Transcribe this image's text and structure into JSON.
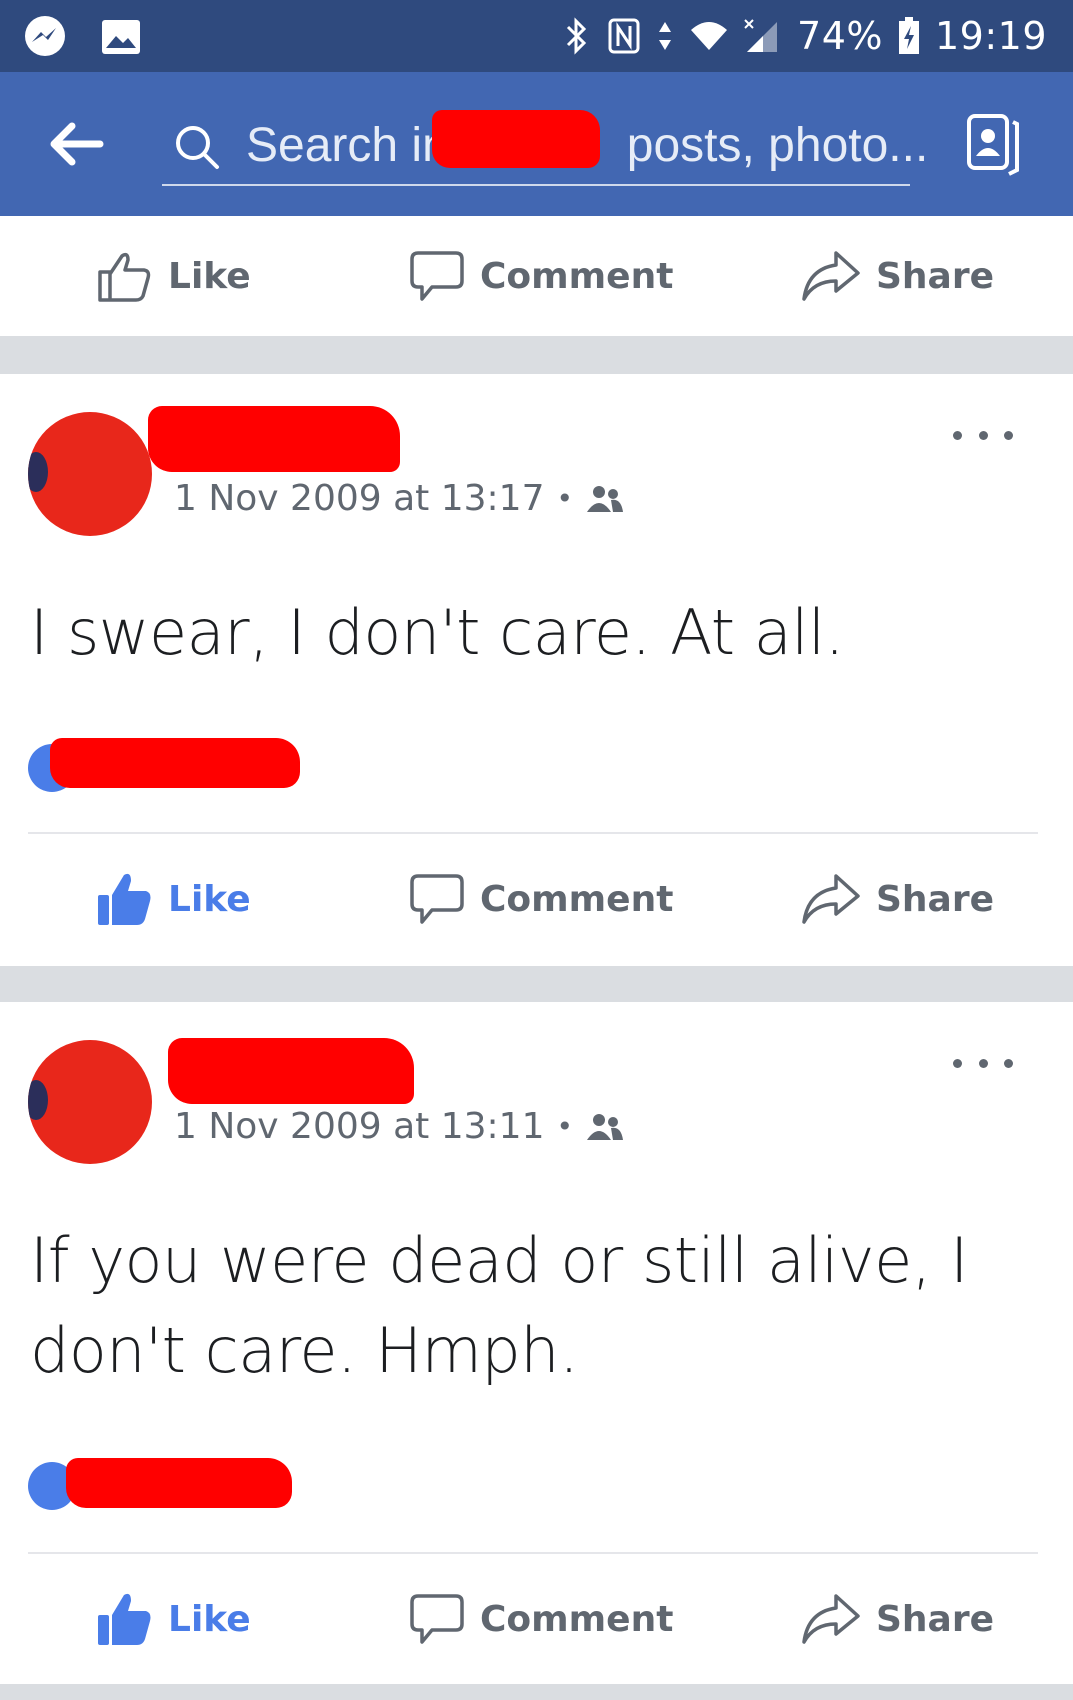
{
  "status_bar": {
    "battery": "74%",
    "time": "19:19",
    "icons": [
      "messenger-icon",
      "gallery-icon",
      "bluetooth-icon",
      "nfc-icon",
      "data-arrows-icon",
      "wifi-icon",
      "signal-icon",
      "battery-charging-icon"
    ]
  },
  "search_bar": {
    "text_before": "Search in",
    "text_after": "posts, photo..."
  },
  "actions": {
    "like": "Like",
    "comment": "Comment",
    "share": "Share"
  },
  "posts": [
    {
      "timestamp": "1 Nov 2009 at 13:17",
      "text": "I swear, I don't care. At all.",
      "liked": true
    },
    {
      "timestamp": "1 Nov 2009 at 13:11",
      "text": "If you were dead or still alive, I don't care. Hmph.",
      "liked": true
    }
  ],
  "colors": {
    "status_bar": "#2f4a7e",
    "header": "#4267b2",
    "like_active": "#4a7de8",
    "redaction": "#ff0000"
  }
}
